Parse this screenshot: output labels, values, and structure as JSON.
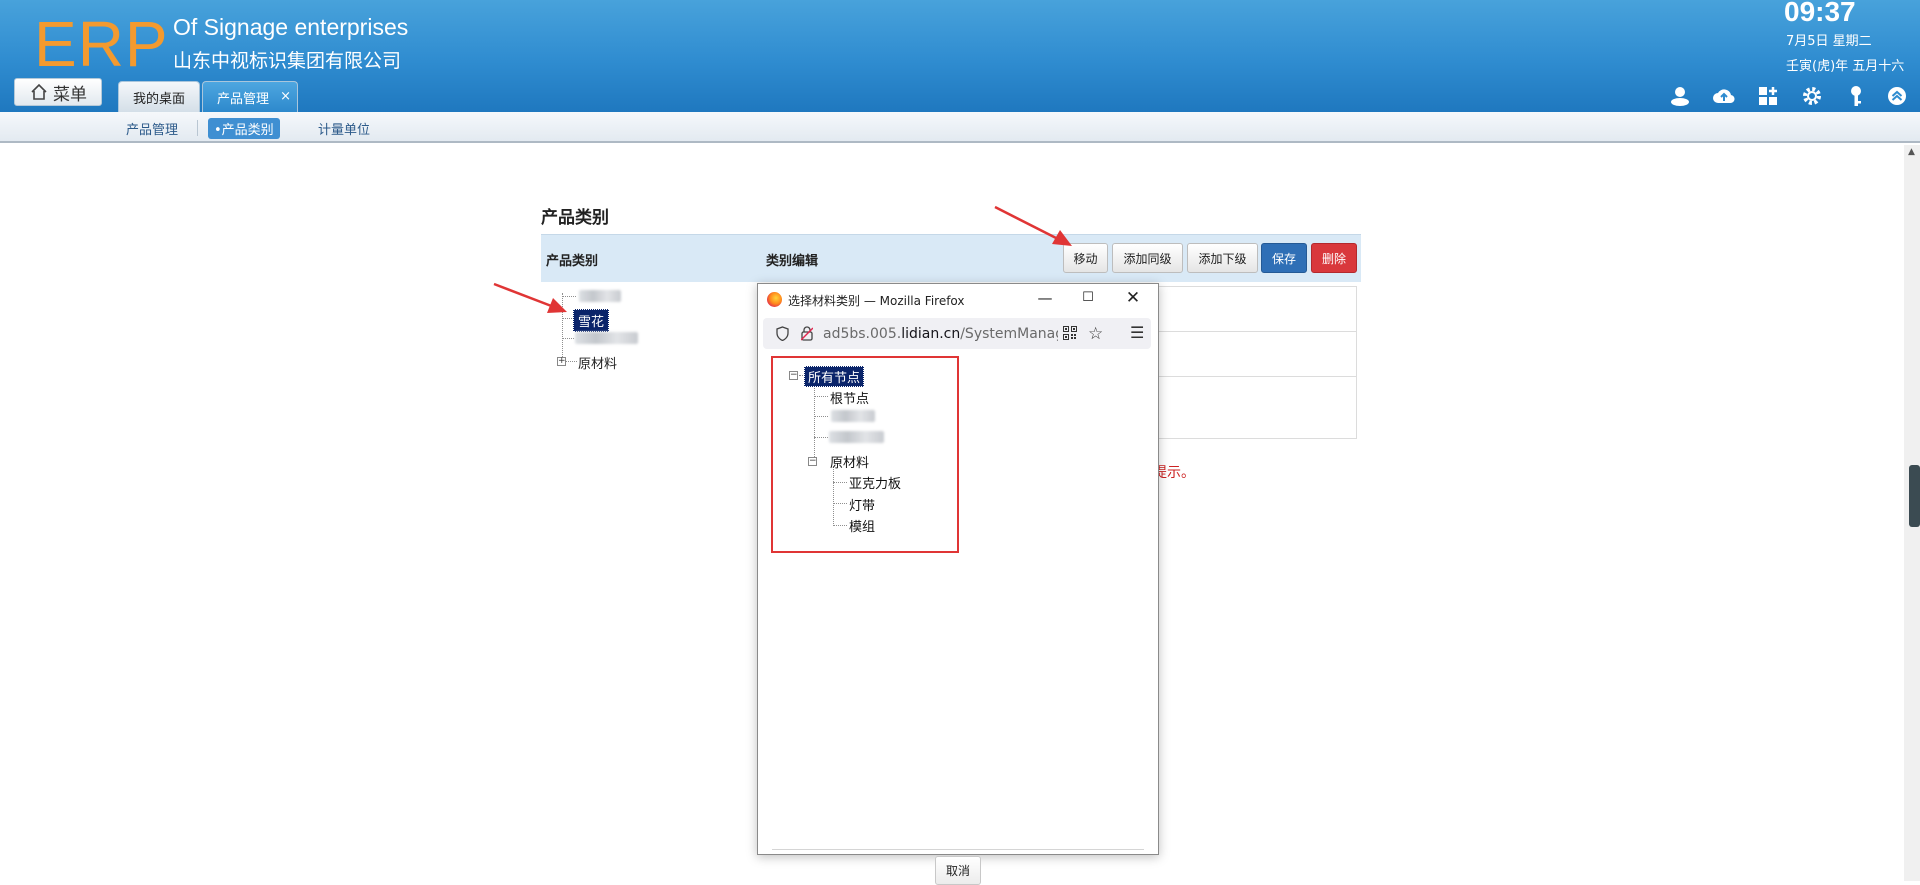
{
  "header": {
    "logo_text": "ERP",
    "company_en": "Of Signage enterprises",
    "company_cn": "山东中视标识集团有限公司",
    "clock": {
      "time": "09:37",
      "date": "7月5日 星期二",
      "lunar": "壬寅(虎)年 五月十六"
    },
    "menu_label": "菜单",
    "tabs": [
      {
        "label": "我的桌面"
      },
      {
        "label": "产品管理",
        "close": "×"
      }
    ],
    "icons": [
      "user-icon",
      "cloud-upload-icon",
      "grid-add-icon",
      "gear-icon",
      "key-icon",
      "collapse-up-icon"
    ]
  },
  "subnav": {
    "items": [
      {
        "label": "产品管理"
      },
      {
        "label": "•产品类别"
      },
      {
        "label": "计量单位"
      }
    ]
  },
  "main": {
    "title": "产品类别",
    "columns": {
      "category": "产品类别",
      "edit": "类别编辑"
    },
    "buttons": {
      "move": "移动",
      "add_sibling": "添加同级",
      "add_child": "添加下级",
      "save": "保存",
      "delete": "删除"
    },
    "tree": {
      "selected": "雪花",
      "raw_materials": "原材料",
      "expand_glyph": "+"
    },
    "hint": "提示。"
  },
  "popup": {
    "title": "选择材料类别 — Mozilla Firefox",
    "url_prefix": "ad5bs.005.",
    "url_domain": "lidian.cn",
    "url_path": "/SystemManage",
    "tree": {
      "all_nodes": "所有节点",
      "root_node": "根节点",
      "raw_materials": "原材料",
      "children": [
        "亚克力板",
        "灯带",
        "模组"
      ],
      "collapse_glyph": "−"
    },
    "cancel": "取消"
  },
  "colors": {
    "header_blue": "#2f8cd0",
    "logo_orange": "#f39a2f",
    "save_blue": "#2f6fb6",
    "delete_red": "#d9383c",
    "annotation_red": "#e03535"
  }
}
